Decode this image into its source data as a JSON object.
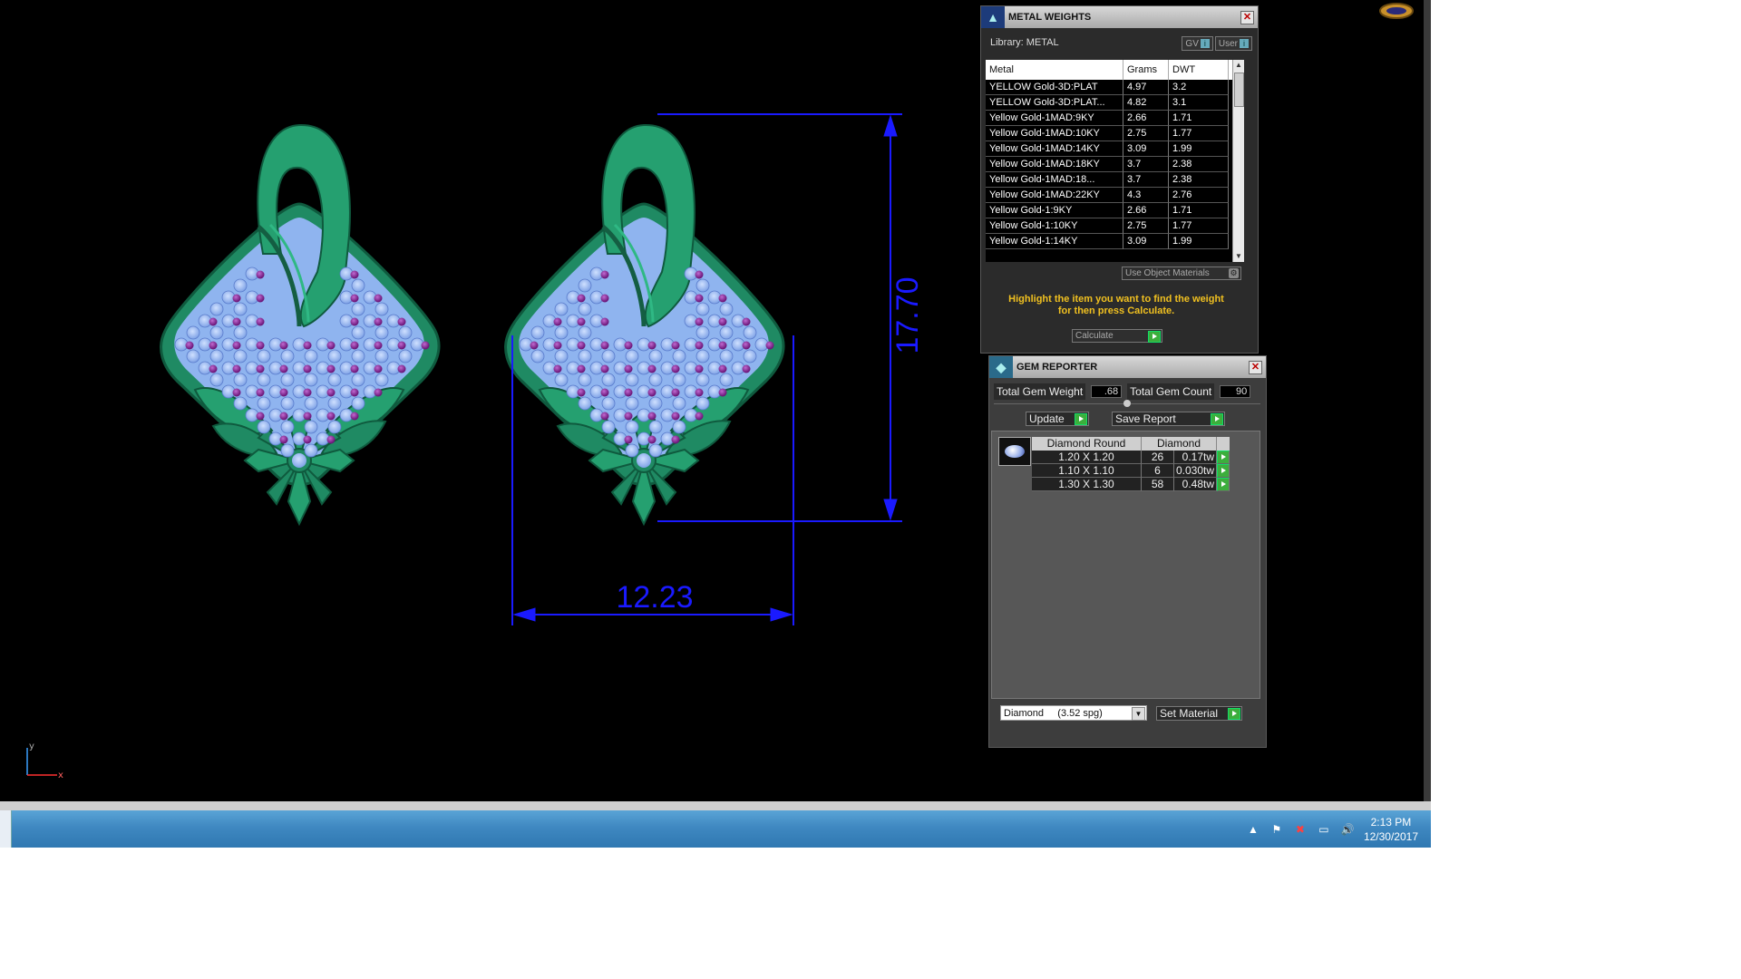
{
  "viewport": {
    "dimension_vertical": "17.70",
    "dimension_horizontal": "12.23",
    "axis_y_label": "y",
    "axis_x_label": "x"
  },
  "metal_weights": {
    "title": "METAL WEIGHTS",
    "library_label": "Library: METAL",
    "gv_label": "GV",
    "user_label": "User",
    "info_glyph": "i",
    "columns": [
      "Metal",
      "Grams",
      "DWT"
    ],
    "rows": [
      {
        "metal": "YELLOW Gold-3D:PLAT",
        "grams": "4.97",
        "dwt": "3.2"
      },
      {
        "metal": "YELLOW Gold-3D:PLAT...",
        "grams": "4.82",
        "dwt": "3.1"
      },
      {
        "metal": "Yellow Gold-1MAD:9KY",
        "grams": "2.66",
        "dwt": "1.71"
      },
      {
        "metal": "Yellow Gold-1MAD:10KY",
        "grams": "2.75",
        "dwt": "1.77"
      },
      {
        "metal": "Yellow Gold-1MAD:14KY",
        "grams": "3.09",
        "dwt": "1.99"
      },
      {
        "metal": "Yellow Gold-1MAD:18KY",
        "grams": "3.7",
        "dwt": "2.38"
      },
      {
        "metal": "Yellow Gold-1MAD:18...",
        "grams": "3.7",
        "dwt": "2.38"
      },
      {
        "metal": "Yellow Gold-1MAD:22KY",
        "grams": "4.3",
        "dwt": "2.76"
      },
      {
        "metal": "Yellow Gold-1:9KY",
        "grams": "2.66",
        "dwt": "1.71"
      },
      {
        "metal": "Yellow Gold-1:10KY",
        "grams": "2.75",
        "dwt": "1.77"
      },
      {
        "metal": "Yellow Gold-1:14KY",
        "grams": "3.09",
        "dwt": "1.99"
      }
    ],
    "use_object_materials": "Use Object Materials",
    "hint_line1": "Highlight the item you want to find the weight",
    "hint_line2": "for then press Calculate.",
    "calculate_label": "Calculate"
  },
  "gem_reporter": {
    "title": "GEM REPORTER",
    "total_weight_label": "Total Gem Weight",
    "total_weight_value": ".68",
    "total_count_label": "Total Gem Count",
    "total_count_value": "90",
    "update_label": "Update",
    "save_report_label": "Save Report",
    "table_header_shape": "Diamond Round",
    "table_header_material": "Diamond",
    "rows": [
      {
        "size": "1.20 X 1.20",
        "count": "26",
        "weight": "0.17tw"
      },
      {
        "size": "1.10 X 1.10",
        "count": "6",
        "weight": "0.030tw"
      },
      {
        "size": "1.30 X 1.30",
        "count": "58",
        "weight": "0.48tw"
      }
    ],
    "material_select": "Diamond     (3.52 spg)",
    "set_material_label": "Set Material"
  },
  "taskbar": {
    "time": "2:13 PM",
    "date": "12/30/2017"
  },
  "colors": {
    "metal_green": "#1f8a63",
    "gem_blue": "#8fb4ef",
    "gem_purple": "#8a2a9a",
    "dimension_blue": "#1a1aff",
    "hint_yellow": "#f0c020"
  }
}
